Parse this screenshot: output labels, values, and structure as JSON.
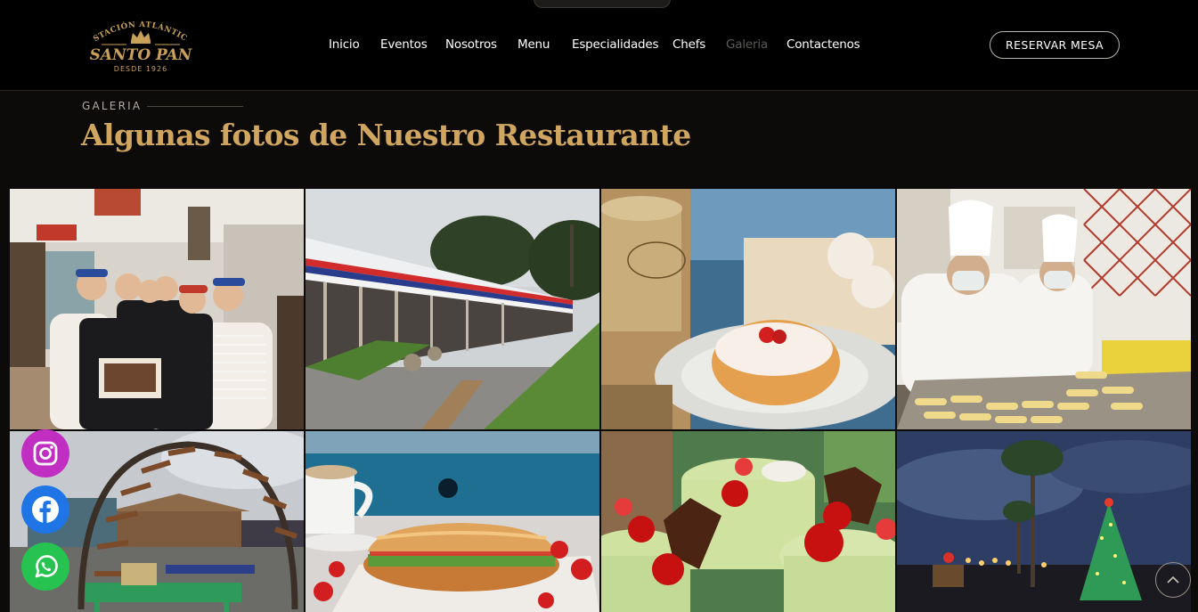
{
  "brand": {
    "arc_text": "ESTACIÓN ATLÁNTICO",
    "name": "SANTO PAN",
    "since": "DESDE 1926",
    "logo_color": "#c9a05a"
  },
  "nav": {
    "items": [
      {
        "label": "Inicio"
      },
      {
        "label": "Eventos"
      },
      {
        "label": "Nosotros"
      },
      {
        "label": "Menu"
      },
      {
        "label": "Especialidades"
      },
      {
        "label": "Chefs"
      },
      {
        "label": "Galeria",
        "active": true
      },
      {
        "label": "Contactenos"
      }
    ],
    "cta": "RESERVAR MESA"
  },
  "section": {
    "label": "GALERIA",
    "title": "Algunas fotos de Nuestro Restaurante",
    "title_color": "#cfa560"
  },
  "gallery": {
    "photos": [
      {
        "name": "staff-group-photo"
      },
      {
        "name": "station-building-photo"
      },
      {
        "name": "donut-dessert-photo"
      },
      {
        "name": "bakers-photo"
      },
      {
        "name": "garden-arch-photo"
      },
      {
        "name": "sandwich-photo"
      },
      {
        "name": "cherry-desserts-photo"
      },
      {
        "name": "christmas-tree-photo"
      }
    ]
  },
  "social": [
    {
      "name": "instagram-icon",
      "color": "#c02fc2"
    },
    {
      "name": "facebook-icon",
      "color": "#1f75e6"
    },
    {
      "name": "whatsapp-icon",
      "color": "#27c351"
    }
  ],
  "scroll_top_icon": "chevron-up-icon"
}
